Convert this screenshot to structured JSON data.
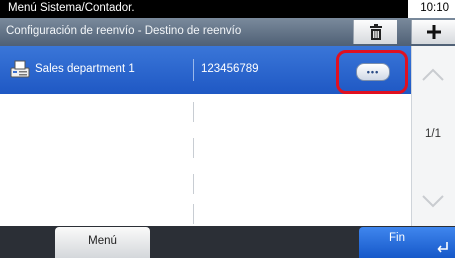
{
  "header": {
    "title": "Menú Sistema/Contador.",
    "time": "10:10"
  },
  "subheader": {
    "title": "Configuración de reenvío - Destino de reenvío",
    "icons": [
      "trash-icon",
      "plus-icon"
    ]
  },
  "list": {
    "rows": [
      {
        "name": "Sales department 1",
        "number": "123456789",
        "icon": "fax-icon",
        "selected": true,
        "detail_icon": "more-options-icon"
      },
      {
        "name": "",
        "number": ""
      },
      {
        "name": "",
        "number": ""
      },
      {
        "name": "",
        "number": ""
      },
      {
        "name": "",
        "number": ""
      }
    ]
  },
  "pagination": {
    "page": "1/1",
    "icons": [
      "chevron-up-icon",
      "chevron-down-icon"
    ]
  },
  "footer": {
    "menu_label": "Menú",
    "fin_label": "Fin",
    "fin_icon": "enter-icon"
  },
  "colors": {
    "selected_row": "#2a66d0",
    "highlight_ring": "#e01020",
    "fin_button": "#1f66dc",
    "topbar": "#000000"
  }
}
